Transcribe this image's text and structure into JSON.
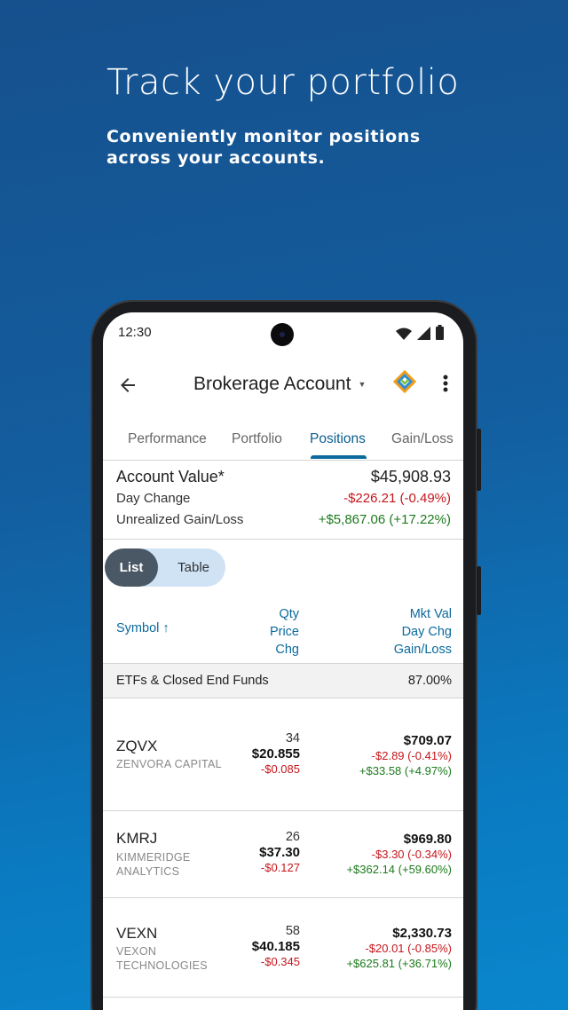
{
  "promo": {
    "headline": "Track your portfolio",
    "subhead": "Conveniently monitor positions across your accounts."
  },
  "status": {
    "time": "12:30"
  },
  "appbar": {
    "title": "Brokerage Account"
  },
  "tabs": [
    {
      "label": "Performance",
      "active": false
    },
    {
      "label": "Portfolio",
      "active": false
    },
    {
      "label": "Positions",
      "active": true
    },
    {
      "label": "Gain/Loss",
      "active": false
    }
  ],
  "summary": {
    "account_value_label": "Account Value*",
    "account_value": "$45,908.93",
    "day_change_label": "Day Change",
    "day_change": "-$226.21 (-0.49%)",
    "unrealized_label": "Unrealized Gain/Loss",
    "unrealized": "+$5,867.06 (+17.22%)"
  },
  "view_toggle": {
    "list": "List",
    "table": "Table",
    "selected": "List"
  },
  "columns": {
    "symbol": "Symbol",
    "sort_arrow": "↑",
    "mid": [
      "Qty",
      "Price",
      "Chg"
    ],
    "right": [
      "Mkt Val",
      "Day Chg",
      "Gain/Loss"
    ]
  },
  "group": {
    "name": "ETFs & Closed End Funds",
    "weight": "87.00%"
  },
  "positions": [
    {
      "symbol": "ZQVX",
      "name": "ZENVORA CAPITAL",
      "qty": "34",
      "price": "$20.855",
      "chg": "-$0.085",
      "mkt_val": "$709.07",
      "day_chg": "-$2.89 (-0.41%)",
      "gain_loss": "+$33.58 (+4.97%)"
    },
    {
      "symbol": "KMRJ",
      "name": "KIMMERIDGE ANALYTICS",
      "name_lines": [
        "KIMMERIDGE",
        "ANALYTICS"
      ],
      "qty": "26",
      "price": "$37.30",
      "chg": "-$0.127",
      "mkt_val": "$969.80",
      "day_chg": "-$3.30 (-0.34%)",
      "gain_loss": "+$362.14 (+59.60%)"
    },
    {
      "symbol": "VEXN",
      "name": "VEXON TECHNOLOGIES",
      "name_lines": [
        "VEXON",
        "TECHNOLOGIES"
      ],
      "qty": "58",
      "price": "$40.185",
      "chg": "-$0.345",
      "mkt_val": "$2,330.73",
      "day_chg": "-$20.01 (-0.85%)",
      "gain_loss": "+$625.81 (+36.71%)"
    }
  ],
  "colors": {
    "accent": "#0b6a9c",
    "negative": "#c4161c",
    "positive": "#1c7a1c",
    "toggle_selected": "#4a5866",
    "toggle_unselected": "#cfe3f5"
  }
}
